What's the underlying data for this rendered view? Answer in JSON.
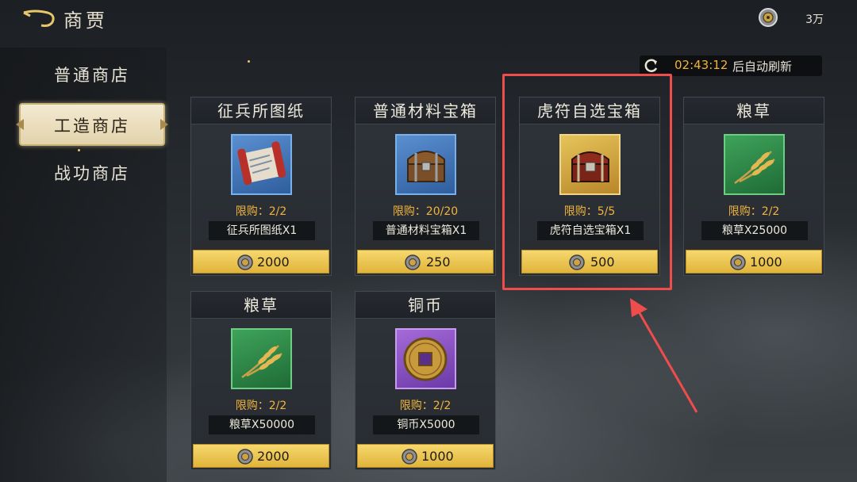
{
  "header": {
    "title": "商贾",
    "currency_amount": "3万"
  },
  "sidebar": {
    "items": [
      {
        "label": "普通商店"
      },
      {
        "label": "工造商店",
        "active": true
      },
      {
        "label": "战功商店"
      }
    ]
  },
  "refresh": {
    "time": "02:43:12",
    "text": "后自动刷新"
  },
  "cards": [
    {
      "title": "征兵所图纸",
      "icon": "scroll-blueprint-icon",
      "frame": "blue",
      "limit": "限购：2/2",
      "name": "征兵所图纸X1",
      "price": "2000"
    },
    {
      "title": "普通材料宝箱",
      "icon": "wooden-chest-icon",
      "frame": "blue",
      "limit": "限购：20/20",
      "name": "普通材料宝箱X1",
      "price": "250"
    },
    {
      "title": "虎符自选宝箱",
      "icon": "red-chest-icon",
      "frame": "gold",
      "limit": "限购：5/5",
      "name": "虎符自选宝箱X1",
      "price": "500"
    },
    {
      "title": "粮草",
      "icon": "wheat-icon",
      "frame": "green",
      "limit": "限购：2/2",
      "name": "粮草X25000",
      "price": "1000"
    },
    {
      "title": "粮草",
      "icon": "wheat-icon",
      "frame": "green",
      "limit": "限购：2/2",
      "name": "粮草X50000",
      "price": "2000"
    },
    {
      "title": "铜币",
      "icon": "copper-coin-icon",
      "frame": "purple",
      "limit": "限购：2/2",
      "name": "铜币X5000",
      "price": "1000"
    }
  ],
  "colors": {
    "accent_gold": "#f0b43c",
    "highlight_red": "#ef4c4c",
    "price_button": "#f6d86e"
  }
}
